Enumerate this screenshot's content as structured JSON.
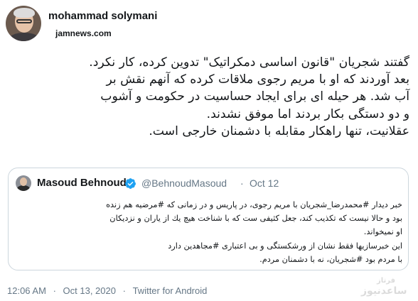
{
  "author": {
    "name": "mohammad solymani",
    "source": "jamnews.com"
  },
  "tweet": {
    "lines": [
      "گفتند شجریان \"قانون اساسی دمکراتیک\" تدوین کرده، کار نکرد.",
      "بعد آوردند که او با مریم رجوی ملاقات کرده که آنهم نقش بر",
      "آب شد. هر حیله ای برای ایجاد حساسیت در حکومت و آشوب",
      "و دو دستگی بکار بردند اما موفق نشدند.",
      "عقلانیت، تنها راهکار مقابله با دشمنان خارجی است."
    ]
  },
  "quoted": {
    "name": "Masoud Behnoud",
    "handle": "@BehnoudMasoud",
    "dot": "·",
    "date": "Oct 12",
    "lines": [
      "خبر دیدار #محمدرضا_شجریان با مریم رجوی، در پاریس و در زمانی که #مرضیه هم زنده",
      "بود و حالا نیست که تکذیب کند، جعل کثیفی ست که با شناخت هیچ یك از یاران و نزدیکان",
      "او نمیخواند.",
      "این خبرسازیها فقط نشان از ورشکستگی و بی اعتباری #مجاهدین دارد",
      "با مردم بود #شجریان، نه با دشمنان مردم."
    ]
  },
  "meta": {
    "time": "12:06 AM",
    "dot": "·",
    "date": "Oct 13, 2020",
    "client": "Twitter for Android"
  },
  "watermark": {
    "top": "فرتاز",
    "bottom": "ساعدنیوز"
  },
  "colors": {
    "verified": "#1da1f2",
    "secondary_text": "#657786",
    "border": "#ccd6dd"
  }
}
